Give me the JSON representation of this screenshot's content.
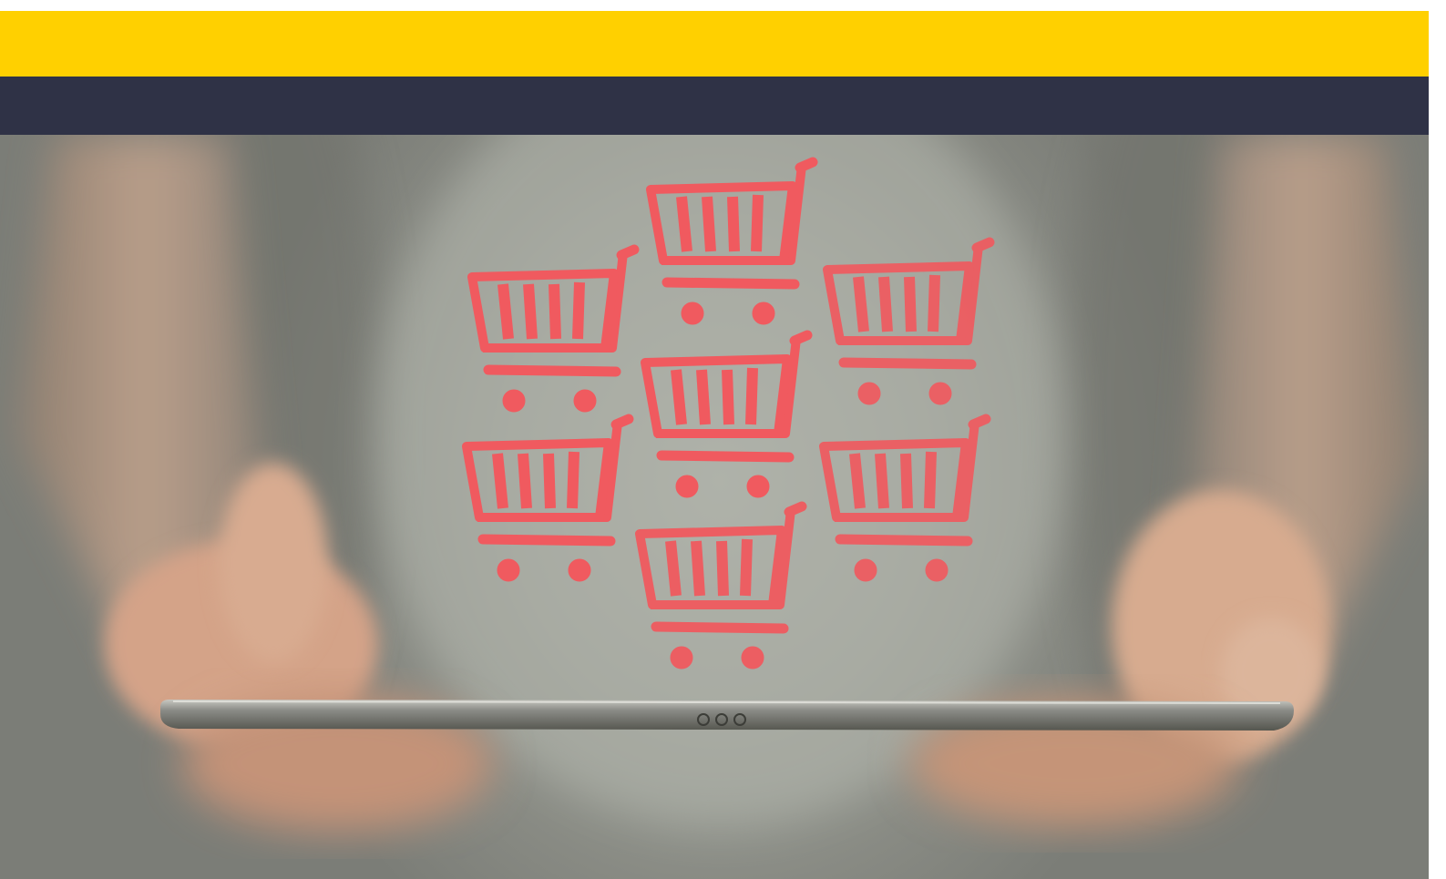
{
  "colors": {
    "header_accent": "#ffd000",
    "header_dark": "#2f3246",
    "cart_icon": "#f05a5f",
    "background_shirt": "#9d9f98",
    "skin": "#d9aa8e",
    "tablet": "#6f706b"
  },
  "image": {
    "subject": "hands-holding-tablet",
    "overlay_icon": "shopping-cart-icon",
    "cart_count": 7
  }
}
